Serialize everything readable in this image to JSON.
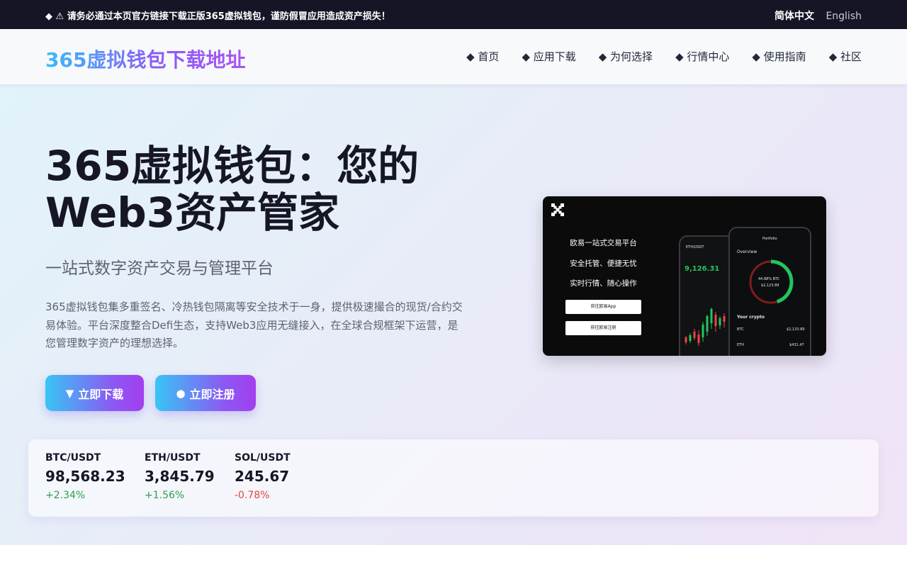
{
  "topbar": {
    "notice": "◆ ⚠ 请务必通过本页官方链接下载正版365虚拟钱包，谨防假冒应用造成资产损失！",
    "languages": [
      "简体中文",
      "English"
    ]
  },
  "header": {
    "logo": "365虚拟钱包下载地址",
    "nav": [
      "◆ 首页",
      "◆ 应用下载",
      "◆ 为何选择",
      "◆ 行情中心",
      "◆ 使用指南",
      "◆ 社区"
    ]
  },
  "hero": {
    "title_line1": "365虚拟钱包：您的",
    "title_line2": "Web3资产管家",
    "subtitle": "一站式数字资产交易与管理平台",
    "description": "365虚拟钱包集多重签名、冷热钱包隔离等安全技术于一身，提供极速撮合的现货/合约交易体验。平台深度整合Defi生态，支持Web3应用无缝接入，在全球合规框架下运营，是您管理数字资产的理想选择。",
    "buttons": {
      "download": {
        "icon": "▼",
        "label": "立即下载"
      },
      "register": {
        "icon": "●",
        "label": "立即注册"
      }
    }
  },
  "banner": {
    "lines": [
      "欧易一站式交易平台",
      "安全托管、便捷无忧",
      "实时行情、随心操作"
    ],
    "button1": "前往欧易App",
    "button2": "前往欧易注册",
    "phone1": {
      "pair": "ETH/USDT",
      "price": "9,126.31"
    },
    "phone2": {
      "title": "Portfolio",
      "overview": "Overview",
      "ring_label": "44.88% BTC",
      "ring_value": "$2,123.89",
      "section": "Your crypto",
      "rows": [
        {
          "coin": "BTC",
          "value": "$2,133.89"
        },
        {
          "coin": "ETH",
          "value": "$431.47"
        }
      ]
    }
  },
  "ticker": [
    {
      "pair": "BTC/USDT",
      "price": "98,568.23",
      "change": "+2.34%",
      "direction": "up"
    },
    {
      "pair": "ETH/USDT",
      "price": "3,845.79",
      "change": "+1.56%",
      "direction": "up"
    },
    {
      "pair": "SOL/USDT",
      "price": "245.67",
      "change": "-0.78%",
      "direction": "down"
    }
  ],
  "colors": {
    "accent_start": "#38c5f5",
    "accent_end": "#a23ef0",
    "up": "#2e9e4c",
    "down": "#e0463f",
    "topbar_bg": "#151526"
  }
}
